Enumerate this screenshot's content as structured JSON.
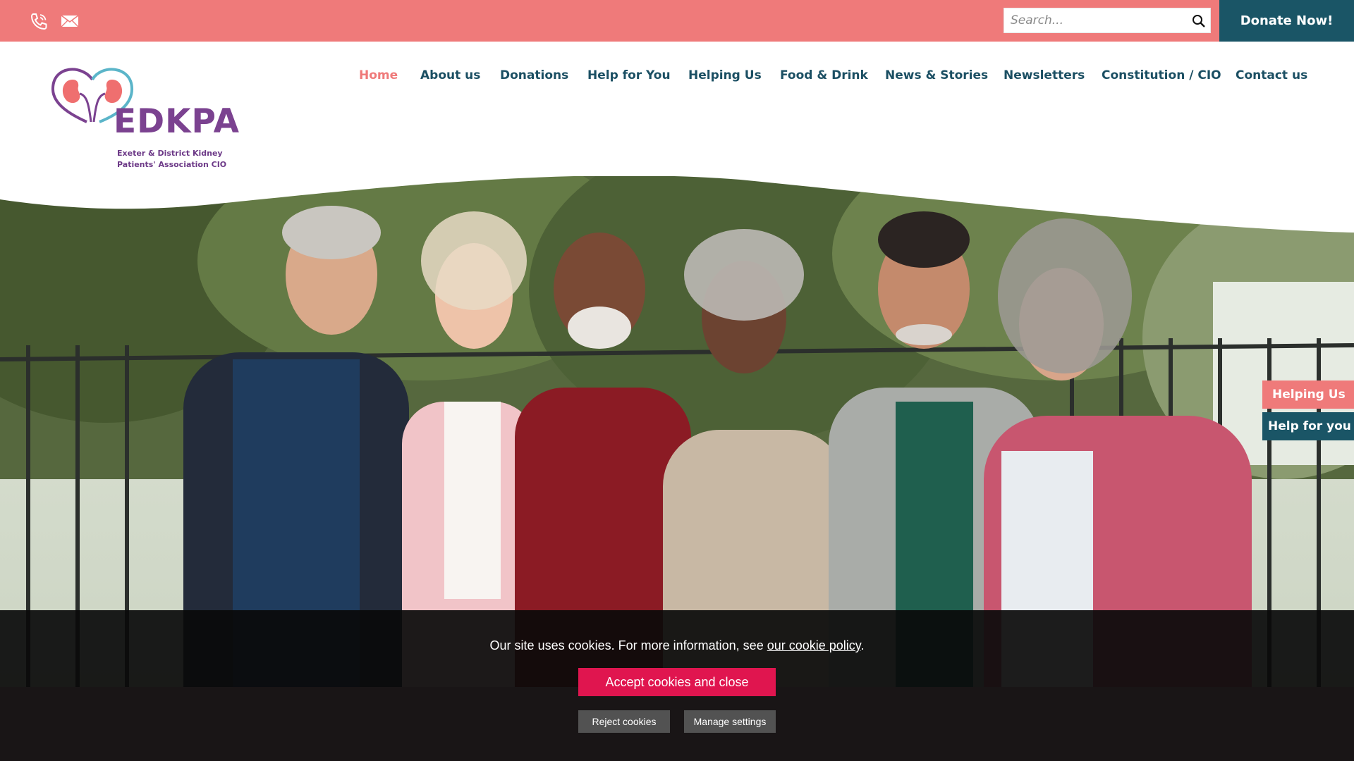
{
  "topbar": {
    "phone_icon": "phone-icon",
    "mail_icon": "mail-icon",
    "search_placeholder": "Search...",
    "search_icon": "search-icon",
    "donate_label": "Donate Now!"
  },
  "logo": {
    "wordmark": "EDKPA",
    "subtitle_line1": "Exeter & District Kidney",
    "subtitle_line2": "Patients' Association CIO"
  },
  "nav": {
    "items": [
      {
        "label": "Home"
      },
      {
        "label": "About us"
      },
      {
        "label": "Donations"
      },
      {
        "label": "Help for You"
      },
      {
        "label": "Helping Us"
      },
      {
        "label": "Food & Drink"
      },
      {
        "label": "News & Stories"
      },
      {
        "label": "Newsletters"
      },
      {
        "label": "Constitution / CIO"
      },
      {
        "label": "Contact us"
      }
    ]
  },
  "side_tabs": {
    "helping_us": "Helping Us",
    "help_for_you": "Help for you"
  },
  "cookie": {
    "message": "Our site uses cookies. For more information, see ",
    "link_text": "our cookie policy",
    "message_end": ".",
    "accept_label": "Accept cookies and close",
    "reject_label": "Reject cookies",
    "manage_label": "Manage settings"
  },
  "colors": {
    "topbar": "#ef7a7a",
    "donate": "#1a5566",
    "nav_text": "#1b4f63",
    "nav_active": "#ef7a7a",
    "accept": "#e0154f",
    "brand_purple": "#7b4290"
  }
}
